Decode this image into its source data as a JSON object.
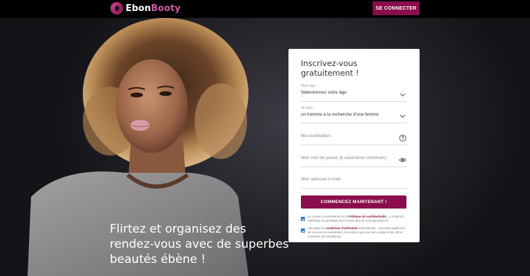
{
  "header": {
    "logo_text_1": "Ebon",
    "logo_text_2": "Booty",
    "login_label": "SE CONNECTER"
  },
  "hero": {
    "tagline": "Flirtez et organisez des rendez-vous avec de superbes beautés ébène !"
  },
  "form": {
    "title": "Inscrivez-vous gratuitement !",
    "age": {
      "label": "Mon âge :",
      "value": "Sélectionnez votre âge"
    },
    "seeking": {
      "label": "Je suis :",
      "value": "un homme à la recherche d'une femme"
    },
    "location": {
      "placeholder": "Ma localisation :"
    },
    "password": {
      "placeholder": "Mon mot de passe (6 caractères minimum) :"
    },
    "email": {
      "placeholder": "Mon adresse e-mail :"
    },
    "submit_label": "COMMENCEZ MAINTENANT !",
    "consent1": {
      "pre": "Je consens expressément à la ",
      "link": "Politique de confidentialité",
      "post": " , y compris à l'utilisation du profilage pour trouver plus de correspondances."
    },
    "consent2": {
      "pre": "J'accepte les ",
      "link": "conditions d'utilisation",
      "post": " d'EbonBooty . J'accepte également de recevoir les newsletters, les mises à jour de mon compte et les offres envoyées par EbonBooty."
    }
  },
  "colors": {
    "brand": "#8a0e4d",
    "checkbox": "#2b6fd6"
  },
  "icons": [
    "logo-icon",
    "chevron-down-icon",
    "help-circle-icon",
    "eye-icon",
    "checkbox-checked-icon"
  ]
}
